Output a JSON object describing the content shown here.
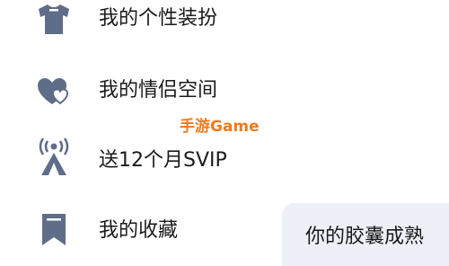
{
  "menu": {
    "items": [
      {
        "label": "我的个性装扮",
        "icon": "shirt-icon"
      },
      {
        "label": "我的情侣空间",
        "icon": "couple-heart-icon"
      },
      {
        "label": "送12个月SVIP",
        "icon": "broadcast-tower-icon"
      },
      {
        "label": "我的收藏",
        "icon": "bookmark-icon"
      }
    ]
  },
  "watermark": {
    "text": "手游Game"
  },
  "capsule": {
    "text": "你的胶囊成熟"
  },
  "colors": {
    "icon": "#5f6d88",
    "text": "#1a1a1a",
    "watermark": "#f07a1a",
    "card_bg": "#eef0f8"
  }
}
